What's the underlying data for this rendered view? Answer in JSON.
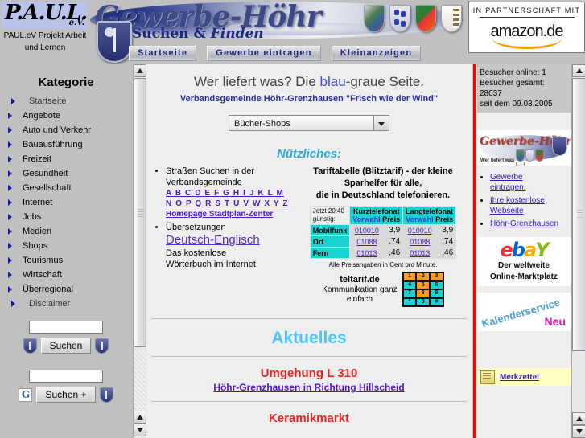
{
  "header": {
    "paul": {
      "logo_text": "P.A.U.L.",
      "ev": "e.V.",
      "sub_line1": "PAUL.eV Projekt Arbeit",
      "sub_line2": "und Lernen"
    },
    "banner_title": "Gewerbe-Höhr",
    "tagline_a": "Suchen & ",
    "tagline_b": "Finden",
    "nav": [
      {
        "label": "Startseite"
      },
      {
        "label": "Gewerbe eintragen"
      },
      {
        "label": "Kleinanzeigen"
      }
    ],
    "amazon": {
      "top": "IN PARTNERSCHAFT MIT",
      "word": "amazon",
      "tld": ".de"
    }
  },
  "sidebar": {
    "title": "Kategorie",
    "items": [
      {
        "label": "Startseite",
        "indent": true
      },
      {
        "label": "Angebote",
        "indent": false
      },
      {
        "label": "Auto und Verkehr",
        "indent": false
      },
      {
        "label": "Bauausführung",
        "indent": false
      },
      {
        "label": "Freizeit",
        "indent": false
      },
      {
        "label": "Gesundheit",
        "indent": false
      },
      {
        "label": "Gesellschaft",
        "indent": false
      },
      {
        "label": "Internet",
        "indent": false
      },
      {
        "label": "Jobs",
        "indent": false
      },
      {
        "label": "Medien",
        "indent": false
      },
      {
        "label": "Shops",
        "indent": false
      },
      {
        "label": "Tourismus",
        "indent": false
      },
      {
        "label": "Wirtschaft",
        "indent": false
      },
      {
        "label": "Überregional",
        "indent": false
      },
      {
        "label": "Disclaimer",
        "indent": true
      }
    ],
    "search1": {
      "value": "",
      "button": "Suchen"
    },
    "search2": {
      "value": "",
      "button": "Suchen +",
      "icon": "G"
    }
  },
  "main": {
    "title_pre": "Wer liefert was? Die ",
    "title_blue": "blau",
    "title_post": "-graue Seite.",
    "subtitle": "Verbandsgemeinde Höhr-Grenzhausen \"Frisch wie der Wind\"",
    "select_value": "Bücher-Shops",
    "nuetzliches": "Nützliches:",
    "bullets": {
      "b1_line1": "Straßen Suchen in der",
      "b1_line2": "Verbandsgemeinde",
      "alpha_row1": "A B C D E F G H I J K L M",
      "alpha_row2": "N O P Q R S T U V W X Y Z",
      "homepage_link": "Homepage Stadtplan-Zenter",
      "b2_line1": "Übersetzungen",
      "de_en": "Deutsch-Englisch",
      "b2_line3": "Das kostenlose",
      "b2_line4": "Wörterbuch im Internet"
    },
    "tarif": {
      "h1": "Tariftabelle (Blitztarif) - der kleine",
      "h2": "Sparhelfer für alle,",
      "h3": "die in Deutschland telefonieren.",
      "jetzt_line1": "Jetzt 20:40",
      "jetzt_line2": "günstig:",
      "col_kurz": "Kurztelefonat",
      "col_lang": "Langtelefonat",
      "sub_vorwahl": "Vorwahl",
      "sub_preis": " Preis",
      "rows": [
        {
          "label": "Mobilfunk",
          "kurz_nr": "010010",
          "kurz_preis": "3,9",
          "lang_nr": "010010",
          "lang_preis": "3,9"
        },
        {
          "label": "Ort",
          "kurz_nr": "01088",
          "kurz_preis": ",74",
          "lang_nr": "01088",
          "lang_preis": ",74"
        },
        {
          "label": "Fern",
          "kurz_nr": "01013",
          "kurz_preis": ",46",
          "lang_nr": "01013",
          "lang_preis": ",46"
        }
      ],
      "footnote": "Alle Preisangaben in Cent pro Minute.",
      "brand": "teltarif.de",
      "slogan_l1": "Kommunikation ganz",
      "slogan_l2": "einfach",
      "keys": [
        "1",
        "2",
        "3",
        "4",
        "5",
        "6",
        "7",
        "8",
        "9",
        "*",
        "0",
        "#"
      ]
    },
    "aktuelles": "Aktuelles",
    "news": [
      {
        "title": "Umgehung L 310",
        "link": "Höhr-Grenzhausen in Richtung Hillscheid"
      },
      {
        "title": "Keramikmarkt",
        "link": ""
      }
    ]
  },
  "rightbar": {
    "visitors": {
      "online": "Besucher online: 1",
      "total": "Besucher gesamt: 28037",
      "since": "seit dem 09.03.2005"
    },
    "gh_banner": {
      "word": "Gewerbe-Höhr",
      "sub": "Wer liefert was"
    },
    "links": [
      {
        "line1": "Gewerbe",
        "line2": "eintragen."
      },
      {
        "line1": "Ihre kostenlose",
        "line2": "Webseite"
      },
      {
        "line1": "Höhr-Grenzhausen",
        "line2": ""
      }
    ],
    "ebay": {
      "e": "e",
      "b": "b",
      "a": "a",
      "y": "Y",
      "line1": "Der weltweite",
      "line2": "Online-Marktplatz"
    },
    "kalender": {
      "text": "Kalenderservice",
      "neu": "Neu"
    },
    "merkzettel": "Merkzettel"
  },
  "colors": {
    "accent_blue": "#3b4fd0",
    "link_purple": "#4c19c2",
    "red_bar": "#fb0000",
    "news_red": "#e8251f",
    "cyan": "#19d2d2",
    "aktuelles_blue": "#4cc4f5"
  }
}
